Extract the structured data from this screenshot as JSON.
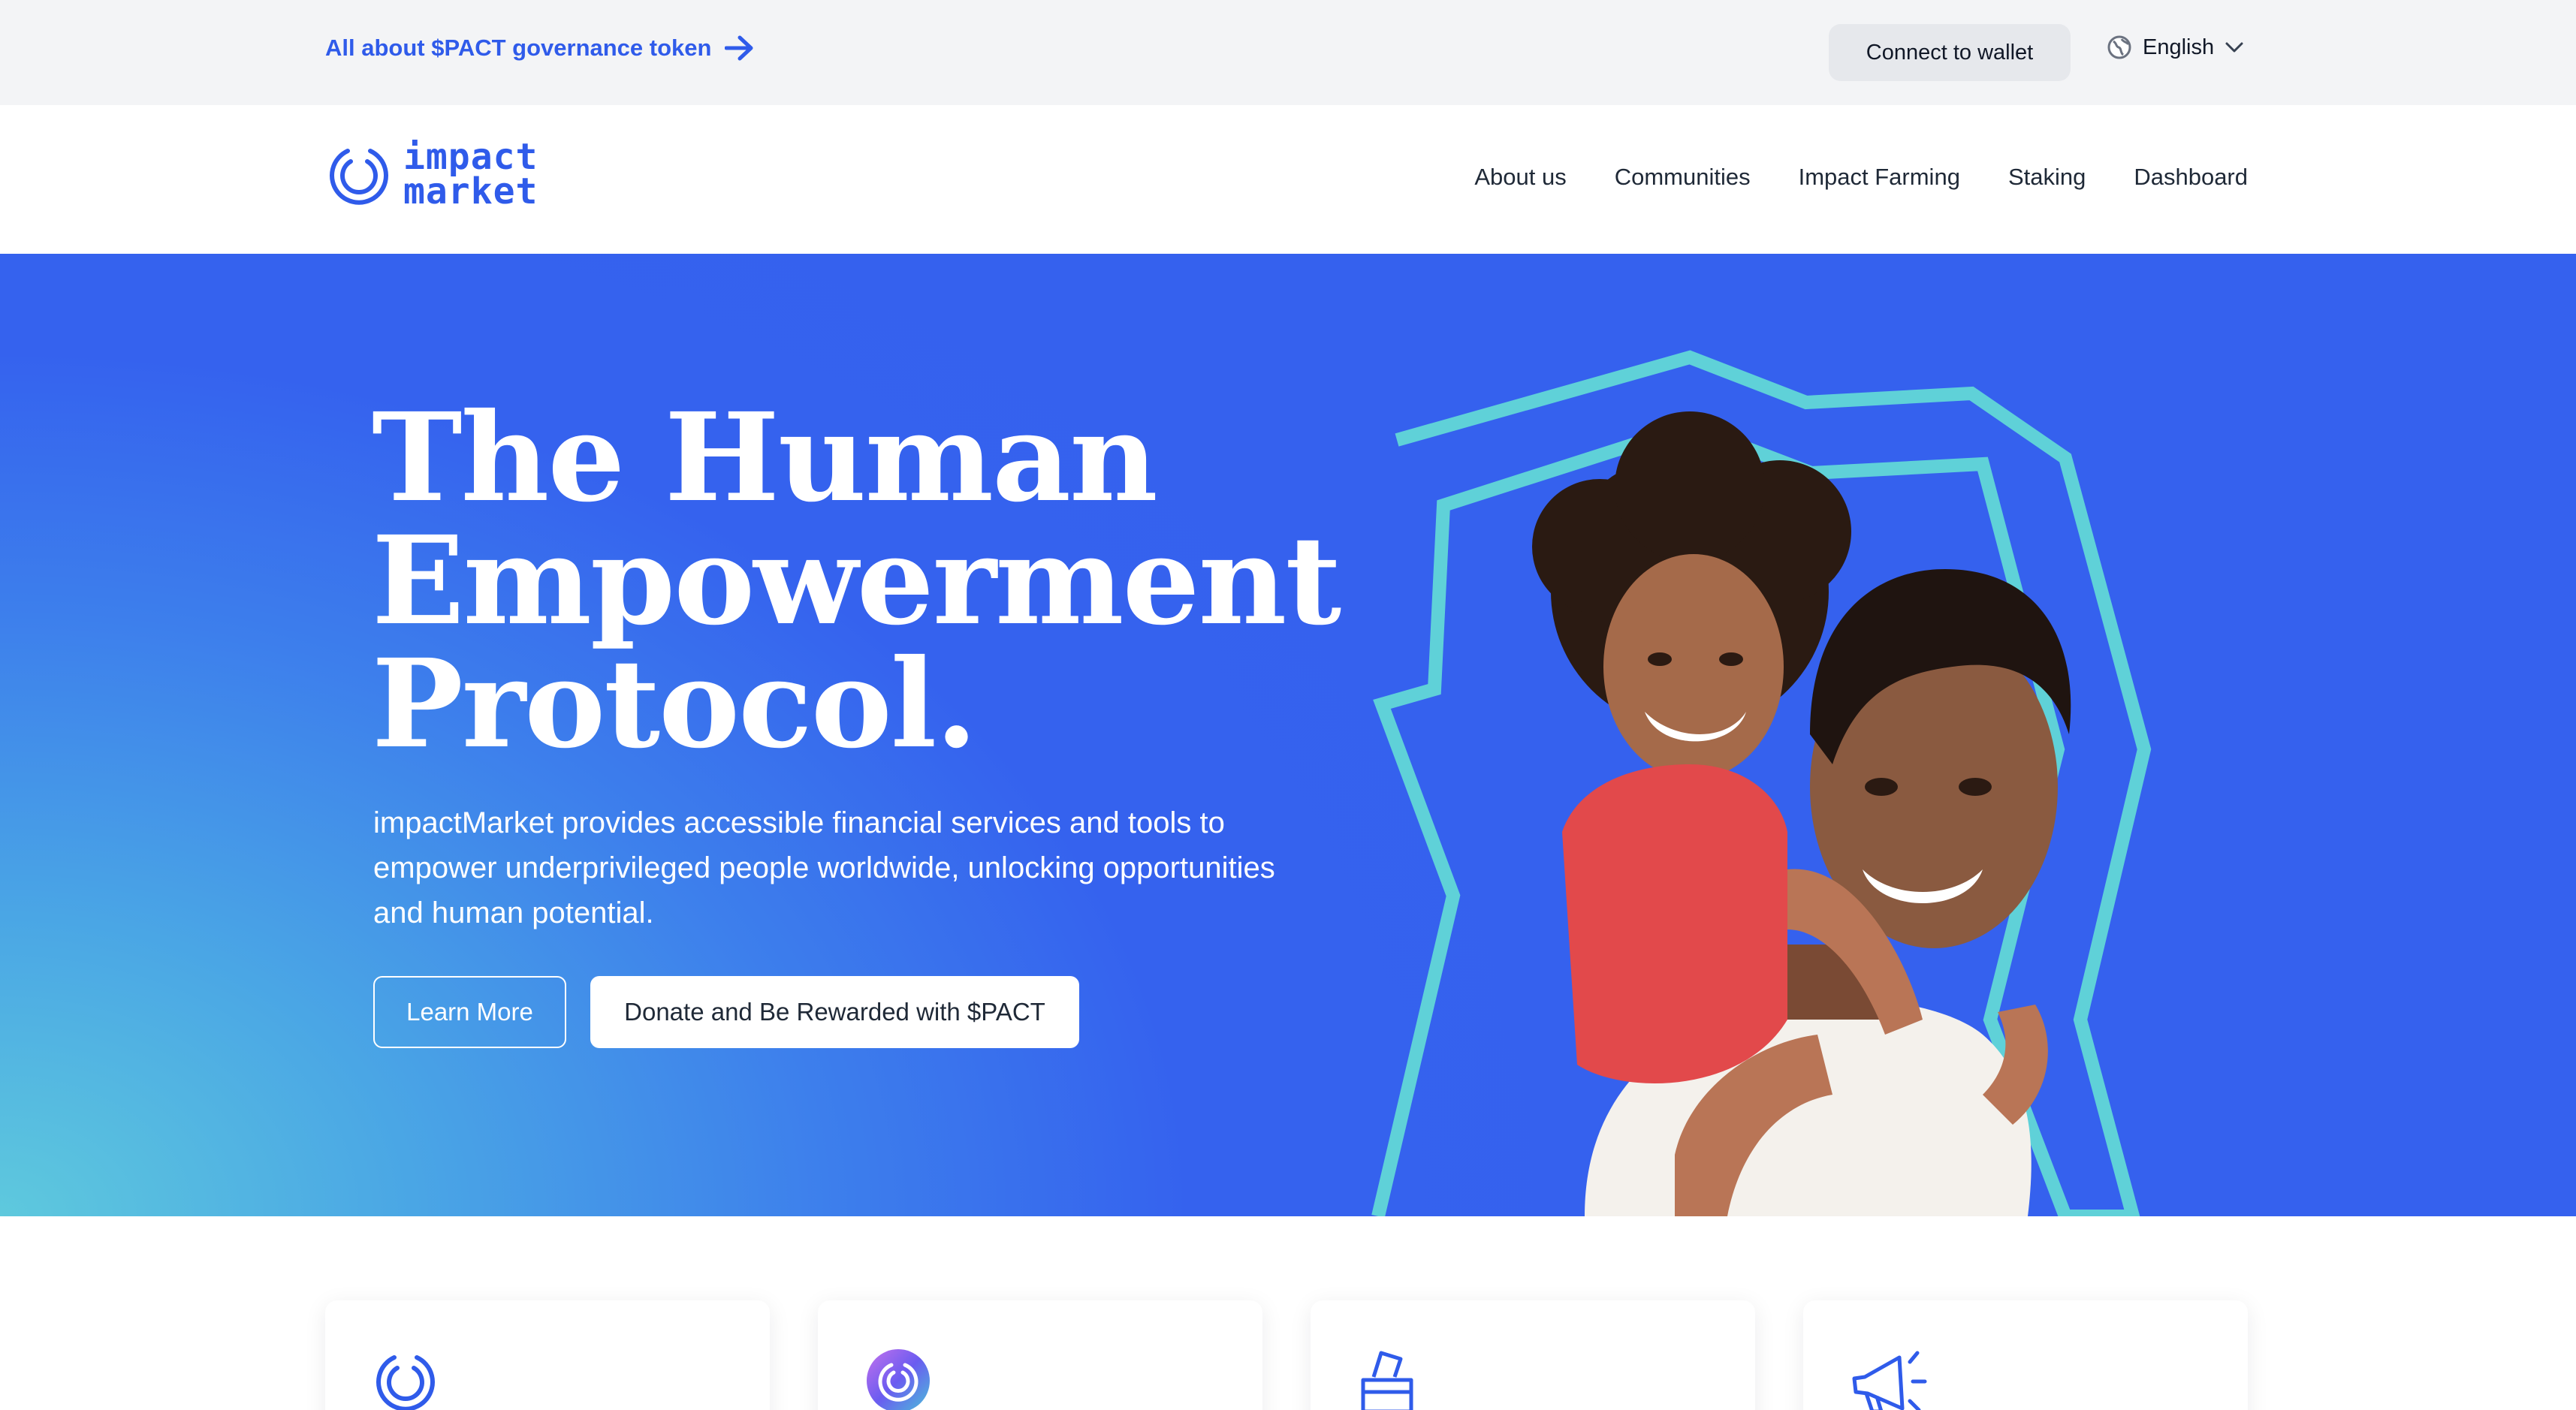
{
  "topbar": {
    "promo_text": "All about $PACT governance token",
    "connect_wallet_label": "Connect to wallet",
    "language": "English",
    "icons": [
      "arrow-right-icon",
      "globe-icon",
      "chevron-down-icon"
    ]
  },
  "nav": {
    "logo_line1": "impact",
    "logo_line2": "market",
    "items": [
      {
        "label": "About us"
      },
      {
        "label": "Communities"
      },
      {
        "label": "Impact Farming"
      },
      {
        "label": "Staking"
      },
      {
        "label": "Dashboard"
      }
    ]
  },
  "hero": {
    "title_line1": "The Human",
    "title_line2": "Empowerment",
    "title_line3": "Protocol.",
    "description": "impactMarket provides accessible financial services and tools to empower underprivileged people worldwide, unlocking opportunities and human potential.",
    "learn_more_label": "Learn More",
    "donate_label": "Donate and Be Rewarded with $PACT"
  },
  "cards": {
    "icons": [
      "impact-logo-icon",
      "pact-token-icon",
      "ballot-box-icon",
      "megaphone-icon"
    ]
  },
  "colors": {
    "brand_blue": "#2f5bea",
    "hero_blue": "#3561ee",
    "hero_teal": "#5ec9dd",
    "outline_teal": "#5fd1d8",
    "topbar_bg": "#f3f4f6"
  }
}
